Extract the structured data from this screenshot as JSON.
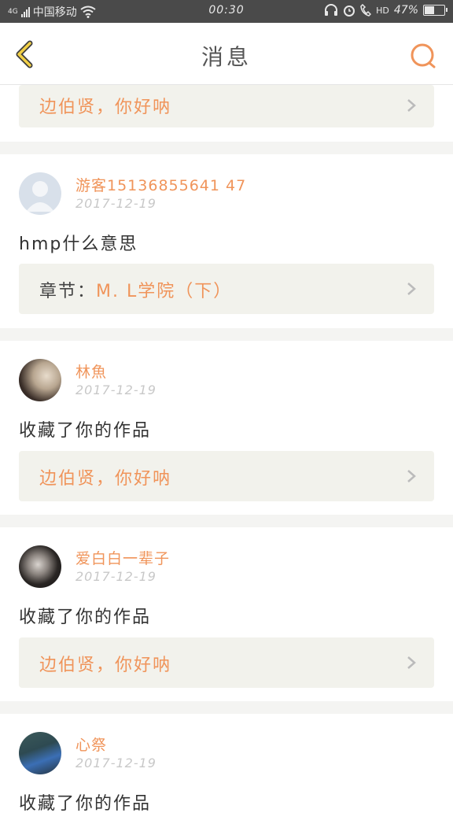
{
  "status_bar": {
    "network": "4G",
    "carrier": "中国移动",
    "time": "00:30",
    "hd": "HD",
    "battery": "47%",
    "battery_level": 0.47
  },
  "header": {
    "title": "消息",
    "back_icon": "chevron-left-icon",
    "search_icon": "search-icon",
    "accent_color": "#f0945a"
  },
  "items": [
    {
      "ref_prefix": "",
      "ref_text": "边伯贤，你好呐"
    },
    {
      "user": "游客15136855641 47",
      "date": "2017-12-19",
      "message": "hmp什么意思",
      "ref_prefix": "章节：",
      "ref_text": "M. L学院（下）"
    },
    {
      "user": "林魚",
      "date": "2017-12-19",
      "message": "收藏了你的作品",
      "ref_prefix": "",
      "ref_text": "边伯贤，你好呐"
    },
    {
      "user": "爱白白一辈子",
      "date": "2017-12-19",
      "message": "收藏了你的作品",
      "ref_prefix": "",
      "ref_text": "边伯贤，你好呐"
    },
    {
      "user": "心祭",
      "date": "2017-12-19",
      "message": "收藏了你的作品"
    }
  ]
}
